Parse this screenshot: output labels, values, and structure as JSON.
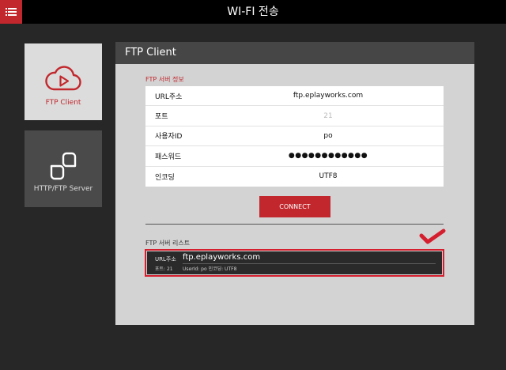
{
  "header": {
    "title": "WI-FI 전송"
  },
  "sidebar": {
    "items": [
      {
        "label": "FTP Client",
        "icon": "cloud-play-icon",
        "active": true
      },
      {
        "label": "HTTP/FTP Server",
        "icon": "link-icon",
        "active": false
      }
    ]
  },
  "panel": {
    "title": "FTP Client",
    "info_section_title": "FTP 서버 정보",
    "fields": {
      "url": {
        "label": "URL주소",
        "value": "ftp.eplayworks.com"
      },
      "port": {
        "label": "포트",
        "placeholder": "21"
      },
      "user": {
        "label": "사용자ID",
        "value": "po"
      },
      "password": {
        "label": "패스워드",
        "value": "●●●●●●●●●●●●"
      },
      "encoding": {
        "label": "인코딩",
        "value": "UTF8"
      }
    },
    "connect_label": "CONNECT",
    "list_section_title": "FTP 서버 리스트",
    "server_list": [
      {
        "url_label": "URL주소",
        "url": "ftp.eplayworks.com",
        "port": "포트: 21",
        "detail": "UserId: po  인코딩: UTF8"
      }
    ]
  },
  "colors": {
    "accent": "#c2272d",
    "panel_bg": "#d3d3d3",
    "header_bg": "#464646",
    "app_bg": "#272727"
  }
}
